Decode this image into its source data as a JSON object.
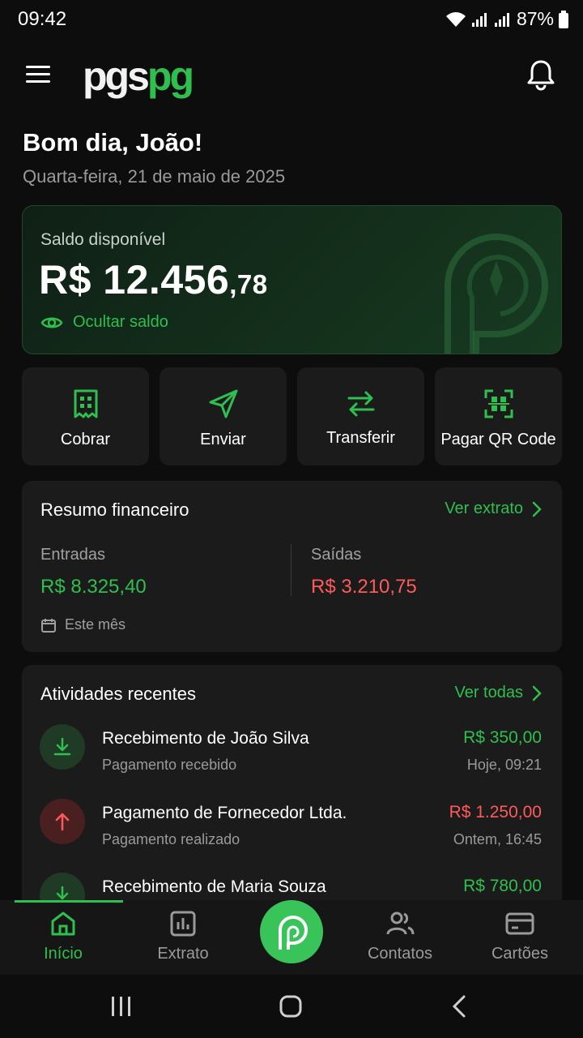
{
  "status_bar": {
    "time": "09:42",
    "battery": "87%"
  },
  "header": {
    "logo_part1": "pgs",
    "logo_part2": "pg",
    "icons": [
      "menu-icon",
      "bell-icon"
    ]
  },
  "greeting": {
    "title": "Bom dia, João!",
    "date": "Quarta-feira, 21 de maio de 2025"
  },
  "balance": {
    "label": "Saldo disponível",
    "value_main": "R$ 12.456",
    "value_cents": ",78",
    "hide_label": "Ocultar saldo"
  },
  "actions": [
    {
      "label": "Cobrar",
      "icon": "receipt-icon"
    },
    {
      "label": "Enviar",
      "icon": "send-icon"
    },
    {
      "label": "Transferir",
      "icon": "transfer-icon"
    },
    {
      "label": "Pagar QR Code",
      "icon": "qr-scan-icon"
    }
  ],
  "summary": {
    "title": "Resumo financeiro",
    "link": "Ver extrato",
    "income_label": "Entradas",
    "income_value": "R$ 8.325,40",
    "expense_label": "Saídas",
    "expense_value": "R$ 3.210,75",
    "period": "Este mês"
  },
  "activity": {
    "title": "Atividades recentes",
    "link": "Ver todas",
    "items": [
      {
        "title": "Recebimento de João Silva",
        "subtitle": "Pagamento recebido",
        "amount": "R$ 350,00",
        "time": "Hoje, 09:21",
        "type": "in"
      },
      {
        "title": "Pagamento de Fornecedor Ltda.",
        "subtitle": "Pagamento realizado",
        "amount": "R$ 1.250,00",
        "time": "Ontem, 16:45",
        "type": "out"
      },
      {
        "title": "Recebimento de Maria Souza",
        "subtitle": "",
        "amount": "R$ 780,00",
        "time": "",
        "type": "in"
      }
    ]
  },
  "bottom_nav": [
    {
      "label": "Início",
      "icon": "home-icon",
      "active": true
    },
    {
      "label": "Extrato",
      "icon": "chart-icon",
      "active": false
    },
    {
      "label": "Contatos",
      "icon": "contacts-icon",
      "active": false
    },
    {
      "label": "Cartões",
      "icon": "card-icon",
      "active": false
    }
  ],
  "colors": {
    "accent": "#2fbf4f",
    "negative": "#ff5a5a",
    "background": "#0d0d0d",
    "card": "#1b1b1b"
  }
}
